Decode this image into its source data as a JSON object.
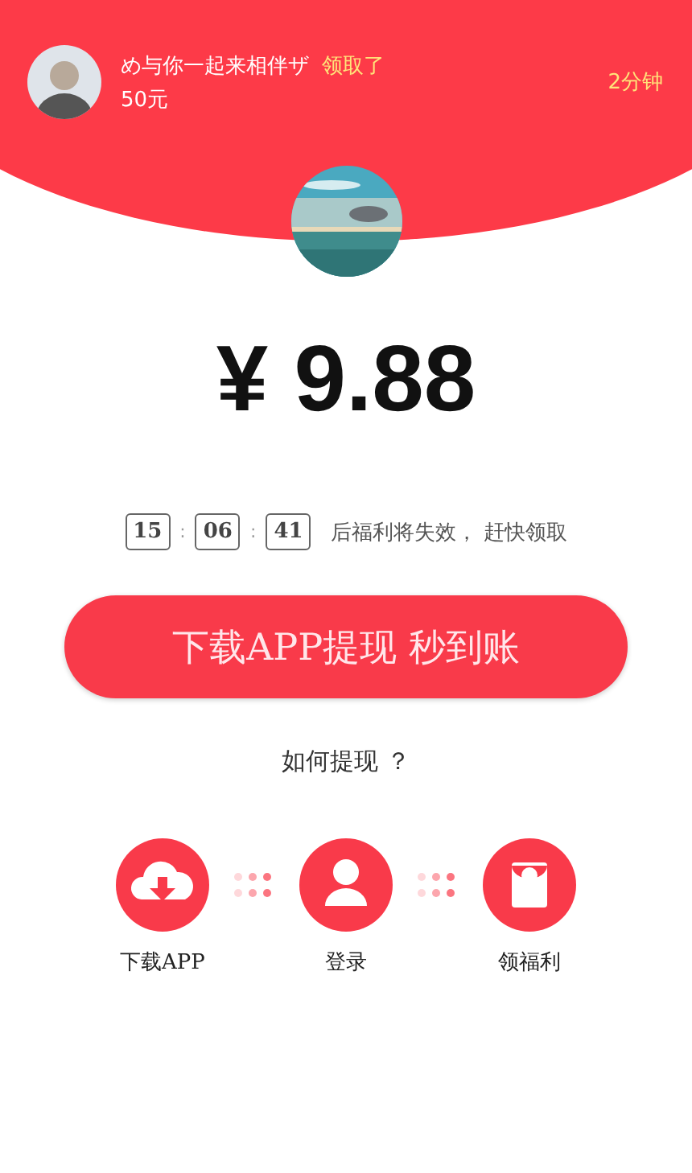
{
  "notice": {
    "user": "め与你一起来相伴ザ",
    "action": "领取了",
    "amount": "50元",
    "time": "2分钟"
  },
  "price": "¥ 9.88",
  "countdown": {
    "units": [
      "15",
      "06",
      "41"
    ],
    "separators": [
      ":",
      ":"
    ],
    "message": "后福利将失效， 赶快领取"
  },
  "cta": {
    "label": "下载APP提现 秒到账"
  },
  "help": {
    "label": "如何提现 ？"
  },
  "steps": [
    {
      "label": "下载APP",
      "kind": "download"
    },
    {
      "label": "登录",
      "kind": "user"
    },
    {
      "label": "领福利",
      "kind": "envelope"
    }
  ]
}
